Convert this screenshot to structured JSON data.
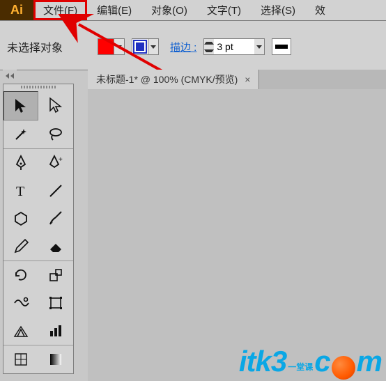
{
  "app_icon": "Ai",
  "menu": {
    "file": "文件(F)",
    "edit": "编辑(E)",
    "object": "对象(O)",
    "type": "文字(T)",
    "select": "选择(S)",
    "effect": "效"
  },
  "options": {
    "no_selection": "未选择对象",
    "stroke_label": "描边 :",
    "stroke_value": "3 pt"
  },
  "tab": {
    "title": "未标题-1* @ 100% (CMYK/预览)",
    "close": "×"
  },
  "watermark": {
    "part1": "itk3",
    "cn": "一堂课",
    "part2": "c",
    "part3": "m"
  }
}
